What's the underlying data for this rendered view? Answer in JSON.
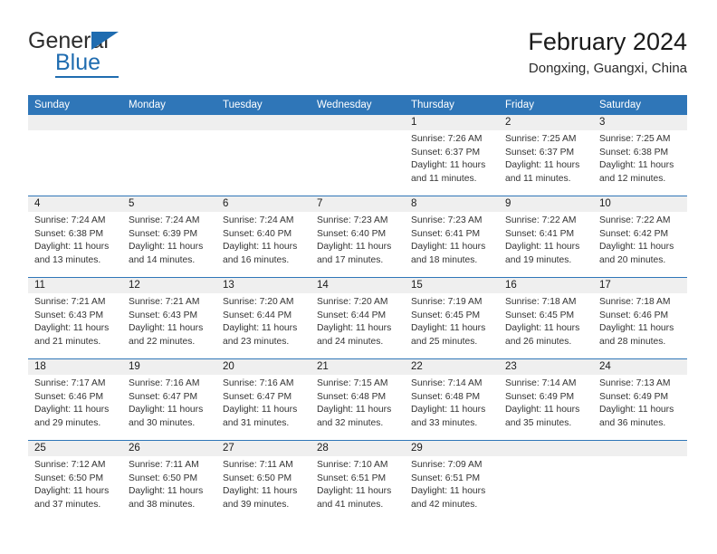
{
  "brand": {
    "name_top": "General",
    "name_bottom": "Blue"
  },
  "header": {
    "title": "February 2024",
    "location": "Dongxing, Guangxi, China"
  },
  "colors": {
    "header_blue": "#2f76b8",
    "brand_blue": "#1f6cb0",
    "daynum_band": "#efefef",
    "text": "#333333"
  },
  "weekdays": [
    "Sunday",
    "Monday",
    "Tuesday",
    "Wednesday",
    "Thursday",
    "Friday",
    "Saturday"
  ],
  "weeks": [
    [
      {
        "day": ""
      },
      {
        "day": ""
      },
      {
        "day": ""
      },
      {
        "day": ""
      },
      {
        "day": "1",
        "sunrise": "Sunrise: 7:26 AM",
        "sunset": "Sunset: 6:37 PM",
        "daylight1": "Daylight: 11 hours",
        "daylight2": "and 11 minutes."
      },
      {
        "day": "2",
        "sunrise": "Sunrise: 7:25 AM",
        "sunset": "Sunset: 6:37 PM",
        "daylight1": "Daylight: 11 hours",
        "daylight2": "and 11 minutes."
      },
      {
        "day": "3",
        "sunrise": "Sunrise: 7:25 AM",
        "sunset": "Sunset: 6:38 PM",
        "daylight1": "Daylight: 11 hours",
        "daylight2": "and 12 minutes."
      }
    ],
    [
      {
        "day": "4",
        "sunrise": "Sunrise: 7:24 AM",
        "sunset": "Sunset: 6:38 PM",
        "daylight1": "Daylight: 11 hours",
        "daylight2": "and 13 minutes."
      },
      {
        "day": "5",
        "sunrise": "Sunrise: 7:24 AM",
        "sunset": "Sunset: 6:39 PM",
        "daylight1": "Daylight: 11 hours",
        "daylight2": "and 14 minutes."
      },
      {
        "day": "6",
        "sunrise": "Sunrise: 7:24 AM",
        "sunset": "Sunset: 6:40 PM",
        "daylight1": "Daylight: 11 hours",
        "daylight2": "and 16 minutes."
      },
      {
        "day": "7",
        "sunrise": "Sunrise: 7:23 AM",
        "sunset": "Sunset: 6:40 PM",
        "daylight1": "Daylight: 11 hours",
        "daylight2": "and 17 minutes."
      },
      {
        "day": "8",
        "sunrise": "Sunrise: 7:23 AM",
        "sunset": "Sunset: 6:41 PM",
        "daylight1": "Daylight: 11 hours",
        "daylight2": "and 18 minutes."
      },
      {
        "day": "9",
        "sunrise": "Sunrise: 7:22 AM",
        "sunset": "Sunset: 6:41 PM",
        "daylight1": "Daylight: 11 hours",
        "daylight2": "and 19 minutes."
      },
      {
        "day": "10",
        "sunrise": "Sunrise: 7:22 AM",
        "sunset": "Sunset: 6:42 PM",
        "daylight1": "Daylight: 11 hours",
        "daylight2": "and 20 minutes."
      }
    ],
    [
      {
        "day": "11",
        "sunrise": "Sunrise: 7:21 AM",
        "sunset": "Sunset: 6:43 PM",
        "daylight1": "Daylight: 11 hours",
        "daylight2": "and 21 minutes."
      },
      {
        "day": "12",
        "sunrise": "Sunrise: 7:21 AM",
        "sunset": "Sunset: 6:43 PM",
        "daylight1": "Daylight: 11 hours",
        "daylight2": "and 22 minutes."
      },
      {
        "day": "13",
        "sunrise": "Sunrise: 7:20 AM",
        "sunset": "Sunset: 6:44 PM",
        "daylight1": "Daylight: 11 hours",
        "daylight2": "and 23 minutes."
      },
      {
        "day": "14",
        "sunrise": "Sunrise: 7:20 AM",
        "sunset": "Sunset: 6:44 PM",
        "daylight1": "Daylight: 11 hours",
        "daylight2": "and 24 minutes."
      },
      {
        "day": "15",
        "sunrise": "Sunrise: 7:19 AM",
        "sunset": "Sunset: 6:45 PM",
        "daylight1": "Daylight: 11 hours",
        "daylight2": "and 25 minutes."
      },
      {
        "day": "16",
        "sunrise": "Sunrise: 7:18 AM",
        "sunset": "Sunset: 6:45 PM",
        "daylight1": "Daylight: 11 hours",
        "daylight2": "and 26 minutes."
      },
      {
        "day": "17",
        "sunrise": "Sunrise: 7:18 AM",
        "sunset": "Sunset: 6:46 PM",
        "daylight1": "Daylight: 11 hours",
        "daylight2": "and 28 minutes."
      }
    ],
    [
      {
        "day": "18",
        "sunrise": "Sunrise: 7:17 AM",
        "sunset": "Sunset: 6:46 PM",
        "daylight1": "Daylight: 11 hours",
        "daylight2": "and 29 minutes."
      },
      {
        "day": "19",
        "sunrise": "Sunrise: 7:16 AM",
        "sunset": "Sunset: 6:47 PM",
        "daylight1": "Daylight: 11 hours",
        "daylight2": "and 30 minutes."
      },
      {
        "day": "20",
        "sunrise": "Sunrise: 7:16 AM",
        "sunset": "Sunset: 6:47 PM",
        "daylight1": "Daylight: 11 hours",
        "daylight2": "and 31 minutes."
      },
      {
        "day": "21",
        "sunrise": "Sunrise: 7:15 AM",
        "sunset": "Sunset: 6:48 PM",
        "daylight1": "Daylight: 11 hours",
        "daylight2": "and 32 minutes."
      },
      {
        "day": "22",
        "sunrise": "Sunrise: 7:14 AM",
        "sunset": "Sunset: 6:48 PM",
        "daylight1": "Daylight: 11 hours",
        "daylight2": "and 33 minutes."
      },
      {
        "day": "23",
        "sunrise": "Sunrise: 7:14 AM",
        "sunset": "Sunset: 6:49 PM",
        "daylight1": "Daylight: 11 hours",
        "daylight2": "and 35 minutes."
      },
      {
        "day": "24",
        "sunrise": "Sunrise: 7:13 AM",
        "sunset": "Sunset: 6:49 PM",
        "daylight1": "Daylight: 11 hours",
        "daylight2": "and 36 minutes."
      }
    ],
    [
      {
        "day": "25",
        "sunrise": "Sunrise: 7:12 AM",
        "sunset": "Sunset: 6:50 PM",
        "daylight1": "Daylight: 11 hours",
        "daylight2": "and 37 minutes."
      },
      {
        "day": "26",
        "sunrise": "Sunrise: 7:11 AM",
        "sunset": "Sunset: 6:50 PM",
        "daylight1": "Daylight: 11 hours",
        "daylight2": "and 38 minutes."
      },
      {
        "day": "27",
        "sunrise": "Sunrise: 7:11 AM",
        "sunset": "Sunset: 6:50 PM",
        "daylight1": "Daylight: 11 hours",
        "daylight2": "and 39 minutes."
      },
      {
        "day": "28",
        "sunrise": "Sunrise: 7:10 AM",
        "sunset": "Sunset: 6:51 PM",
        "daylight1": "Daylight: 11 hours",
        "daylight2": "and 41 minutes."
      },
      {
        "day": "29",
        "sunrise": "Sunrise: 7:09 AM",
        "sunset": "Sunset: 6:51 PM",
        "daylight1": "Daylight: 11 hours",
        "daylight2": "and 42 minutes."
      },
      {
        "day": ""
      },
      {
        "day": ""
      }
    ]
  ]
}
